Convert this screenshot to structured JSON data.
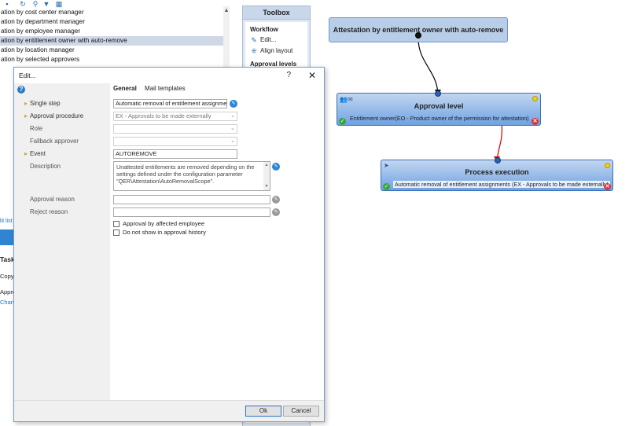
{
  "list": {
    "items": [
      "ation by cost center manager",
      "ation by department manager",
      "ation by employee manager",
      "ation by entitlement owner with auto-remove",
      "ation by location manager",
      "ation by selected approvers",
      "",
      "",
      "",
      "",
      "",
      "",
      "",
      "",
      "",
      "",
      "",
      "",
      "",
      "",
      "",
      ""
    ],
    "bottom_text": "lit list"
  },
  "tasks": {
    "title": "Tasks",
    "item_1": "Copy w",
    "item_2": "Approv",
    "link": "Change"
  },
  "toolbox": {
    "title": "Toolbox",
    "section_workflow": "Workflow",
    "edit_label": "Edit...",
    "align_label": "Align layout",
    "section_approval": "Approval levels"
  },
  "workflow": {
    "start_title": "Attestation by entitlement owner with auto-remove",
    "approval_title": "Approval level",
    "approval_desc": "Entitlement owner(EO - Product owner of the permission for attestation)",
    "exec_title": "Process execution",
    "exec_desc": "Automatic removal of entitlement assignments (EX - Approvals to be made externally)"
  },
  "dialog": {
    "title": "Edit...",
    "help": "?",
    "close": "✕",
    "tabs": {
      "general": "General",
      "mail": "Mail templates"
    },
    "labels": {
      "single_step": "Single step",
      "approval_procedure": "Approval procedure",
      "role": "Role",
      "fallback": "Fallback approver",
      "event": "Event",
      "description": "Description",
      "approval_reason": "Approval reason",
      "reject_reason": "Reject reason"
    },
    "values": {
      "single_step": "Automatic removal of entitlement assignments",
      "approval_procedure": "EX - Approvals to be made externally",
      "role": "",
      "fallback": "",
      "event": "AUTOREMOVE",
      "description": "Unattested entitlements are removed depending on the settings defined under the configuration parameter \"QER\\Attestation\\AutoRemovalScope\".",
      "approval_reason": "",
      "reject_reason": ""
    },
    "checkboxes": {
      "approval_by_affected": "Approval by affected employee",
      "do_not_show": "Do not show in approval history"
    },
    "buttons": {
      "ok": "Ok",
      "cancel": "Cancel"
    }
  },
  "colors": {
    "node_blue": "#6fa2e3",
    "connector_black": "#000000",
    "connector_red": "#d00000",
    "selection": "#cfd8e6"
  }
}
